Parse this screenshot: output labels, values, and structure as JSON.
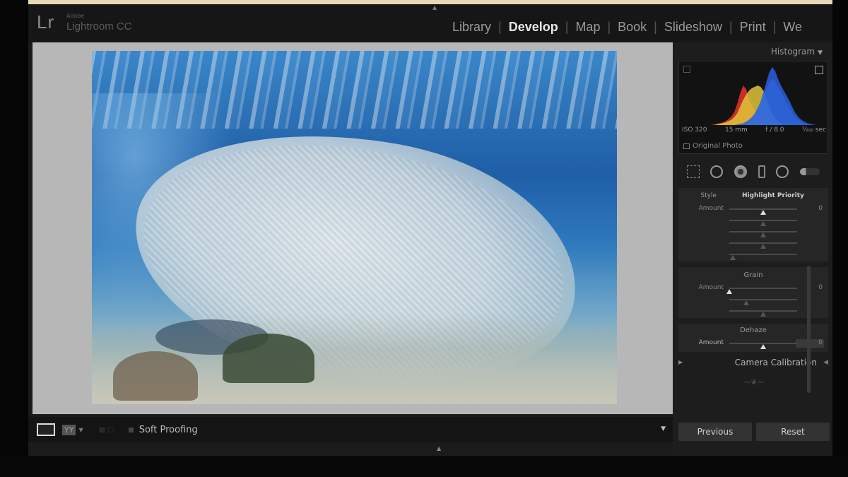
{
  "app": {
    "logo": "Lr",
    "vendor": "Adobe",
    "product": "Lightroom CC"
  },
  "modules": [
    {
      "label": "Library"
    },
    {
      "label": "Develop"
    },
    {
      "label": "Map"
    },
    {
      "label": "Book"
    },
    {
      "label": "Slideshow"
    },
    {
      "label": "Print"
    },
    {
      "label": "We"
    }
  ],
  "active_module": "Develop",
  "histogram": {
    "header": "Histogram",
    "iso": "ISO 320",
    "focal": "15 mm",
    "aperture": "f / 8.0",
    "shutter": "¹⁄₂₀₀ sec",
    "original_photo": "Original Photo"
  },
  "vignette": {
    "style_label": "Style",
    "style_value": "Highlight Priority",
    "amount_label": "Amount",
    "amount_value": "0",
    "amount_level": 0.5,
    "midpoint_level": 0.5,
    "roundness_level": 0.5,
    "feather_level": 0.5,
    "highlights_level": 0.05
  },
  "grain": {
    "title": "Grain",
    "amount_label": "Amount",
    "amount_value": "0",
    "amount_level": 0.0,
    "size_level": 0.25,
    "roughness_level": 0.5
  },
  "dehaze": {
    "title": "Dehaze",
    "amount_label": "Amount",
    "amount_value": "0",
    "amount_level": 0.5
  },
  "camera_calibration": "Camera Calibration",
  "buttons": {
    "previous": "Previous",
    "reset": "Reset"
  },
  "toolbar": {
    "view_mode": "YY",
    "soft_proofing": "Soft Proofing"
  },
  "histogram_series": {
    "red": [
      0,
      0,
      0,
      0,
      0,
      0,
      0,
      0,
      0,
      0,
      0,
      1,
      2,
      3,
      4,
      6,
      9,
      13,
      20,
      32,
      48,
      60,
      55,
      40,
      30,
      22,
      15,
      10,
      6,
      4,
      2,
      1,
      0,
      0,
      0,
      0,
      0,
      0,
      0,
      0,
      0,
      0,
      0,
      0,
      0,
      0,
      0,
      0,
      0,
      0
    ],
    "yellow": [
      0,
      0,
      0,
      0,
      0,
      0,
      0,
      0,
      0,
      0,
      0,
      0,
      1,
      2,
      3,
      4,
      6,
      8,
      12,
      18,
      28,
      38,
      46,
      52,
      56,
      58,
      60,
      58,
      52,
      40,
      28,
      18,
      10,
      6,
      3,
      1,
      0,
      0,
      0,
      0,
      0,
      0,
      0,
      0,
      0,
      0,
      0,
      0,
      0,
      0
    ],
    "blue": [
      0,
      0,
      0,
      0,
      0,
      0,
      0,
      0,
      0,
      0,
      0,
      0,
      0,
      0,
      0,
      0,
      0,
      0,
      0,
      1,
      2,
      3,
      5,
      8,
      12,
      18,
      26,
      36,
      50,
      66,
      80,
      88,
      82,
      70,
      60,
      52,
      44,
      36,
      26,
      18,
      12,
      8,
      5,
      3,
      2,
      1,
      0,
      0,
      0,
      0
    ],
    "cyan": [
      0,
      0,
      0,
      0,
      0,
      0,
      0,
      0,
      0,
      0,
      0,
      0,
      0,
      0,
      0,
      0,
      0,
      0,
      0,
      0,
      1,
      2,
      4,
      6,
      10,
      16,
      24,
      32,
      44,
      56,
      64,
      70,
      66,
      58,
      50,
      42,
      34,
      26,
      18,
      12,
      8,
      5,
      3,
      2,
      1,
      0,
      0,
      0,
      0,
      0
    ]
  }
}
